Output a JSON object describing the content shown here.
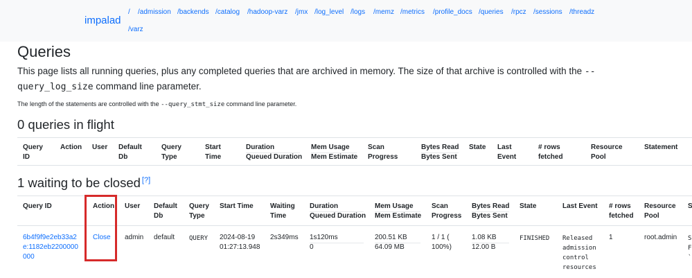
{
  "navbar": {
    "brand": "impalad",
    "links": [
      "/",
      "/admission",
      "/backends",
      "/catalog",
      "/hadoop-varz",
      "/jmx",
      "/log_level",
      "/logs",
      "/memz",
      "/metrics",
      "/profile_docs",
      "/queries",
      "/rpcz",
      "/sessions",
      "/threadz",
      "/varz"
    ]
  },
  "page": {
    "title": "Queries",
    "description_pre": "This page lists all running queries, plus any completed queries that are archived in memory. The size of that archive is controlled with the ",
    "description_code": "--query_log_size",
    "description_post": " command line parameter.",
    "stmt_pre": "The length of the statements are controlled with the ",
    "stmt_code": "--query_stmt_size",
    "stmt_post": " command line parameter."
  },
  "in_flight": {
    "heading": "0 queries in flight",
    "headers": {
      "query_id_1": "Query",
      "query_id_2": "ID",
      "action": "Action",
      "user": "User",
      "default_db_1": "Default",
      "default_db_2": "Db",
      "query_type_1": "Query",
      "query_type_2": "Type",
      "start_time_1": "Start",
      "start_time_2": "Time",
      "duration": "Duration",
      "queued_duration": "Queued Duration",
      "mem_usage": "Mem Usage",
      "mem_estimate": "Mem Estimate",
      "scan_1": "Scan",
      "scan_2": "Progress",
      "bytes_read": "Bytes Read",
      "bytes_sent": "Bytes Sent",
      "state": "State",
      "last_event_1": "Last",
      "last_event_2": "Event",
      "rows_1": "# rows",
      "rows_2": "fetched",
      "pool_1": "Resource",
      "pool_2": "Pool",
      "statement": "Statement"
    }
  },
  "waiting": {
    "heading": "1 waiting to be closed",
    "help": "[?]",
    "headers": {
      "query_id": "Query ID",
      "action": "Action",
      "user": "User",
      "default_db_1": "Default",
      "default_db_2": "Db",
      "query_type_1": "Query",
      "query_type_2": "Type",
      "start_time": "Start Time",
      "waiting_1": "Waiting",
      "waiting_2": "Time",
      "duration": "Duration",
      "queued_duration": "Queued Duration",
      "mem_usage": "Mem Usage",
      "mem_estimate": "Mem Estimate",
      "scan_1": "Scan",
      "scan_2": "Progress",
      "bytes_read": "Bytes Read",
      "bytes_sent": "Bytes Sent",
      "state": "State",
      "last_event": "Last Event",
      "rows_1": "# rows",
      "rows_2": "fetched",
      "pool_1": "Resource",
      "pool_2": "Pool",
      "statement": "S"
    },
    "row": {
      "query_id_1": "6b4f9f9e2eb33a2",
      "query_id_2": "e:1182eb2200000",
      "query_id_3": "000",
      "action": "Close",
      "user": "admin",
      "default_db": "default",
      "query_type": "QUERY",
      "start_date": "2024-08-19",
      "start_clock": "01:27:13.948",
      "waiting_time": "2s349ms",
      "duration": "1s120ms",
      "queued_duration": "0",
      "mem_usage": "200.51 KB",
      "mem_estimate": "64.09 MB",
      "scan_1": "1 / 1 (",
      "scan_2": "100%)",
      "bytes_read": "1.08 KB",
      "bytes_sent": "12.00 B",
      "state": "FINISHED",
      "last_event_1": "Released",
      "last_event_2": "admission",
      "last_event_3": "control",
      "last_event_4": "resources",
      "rows_fetched": "1",
      "pool": "root.admin",
      "stmt_1": "S",
      "stmt_2": "F",
      "stmt_3": "`"
    }
  }
}
